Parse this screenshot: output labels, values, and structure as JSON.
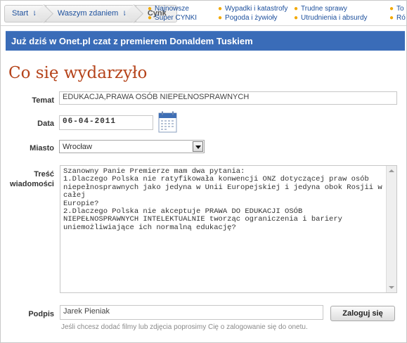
{
  "breadcrumb": {
    "items": [
      {
        "label": "Start",
        "arrow": "⇂"
      },
      {
        "label": "Waszym zdaniem",
        "arrow": "⇂"
      },
      {
        "label": "Cynk",
        "arrow": ""
      }
    ]
  },
  "quicklinks": {
    "row1": [
      "Najnowsze",
      "Wypadki i katastrofy",
      "Trudne sprawy",
      "To"
    ],
    "row2": [
      "Super CYNKI",
      "Pogoda i żywioły",
      "Utrudnienia i absurdy",
      "Ró"
    ]
  },
  "banner": {
    "text": "Już dziś w Onet.pl czat z premierem Donaldem Tuskiem"
  },
  "page_title": "Co się wydarzyło",
  "form": {
    "topic_label": "Temat",
    "topic_value": "EDUKACJA,PRAWA OSÓB NIEPEŁNOSPRAWNYCH",
    "date_label": "Data",
    "date_value": "06-04-2011",
    "city_label": "Miasto",
    "city_value": "Wrocław",
    "message_label_line1": "Treść",
    "message_label_line2": "wiadomości",
    "message_value": "Szanowny Panie Premierze mam dwa pytania:\n1.Dlaczego Polska nie ratyfikowała konwencji ONZ dotyczącej praw osób\nniepełnosprawnych jako jedyna w Unii Europejskiej i jedyna obok Rosjii w całej\nEuropie?\n2.Dlaczego Polska nie akceptuje PRAWA DO EDUKACJI OSÓB\nNIEPEŁNOSPRAWNYCH INTELEKTUALNIE tworząc ograniczenia i bariery\nuniemożliwiające ich normalną edukację?",
    "signature_label": "Podpis",
    "signature_value": "Jarek Pieniak",
    "login_button": "Zaloguj się",
    "note": "Jeśli chcesz dodać filmy lub zdjęcia poprosimy Cię o zalogowanie się do onetu."
  },
  "icons": {
    "calendar": "calendar-icon",
    "quicklink_bullet": "bullet-dot-icon",
    "select_arrow": "chevron-down-icon"
  },
  "colors": {
    "banner": "#3a6cb8",
    "title": "#b5431a",
    "link": "#1c4f9c",
    "bullet": "#f2a900"
  }
}
